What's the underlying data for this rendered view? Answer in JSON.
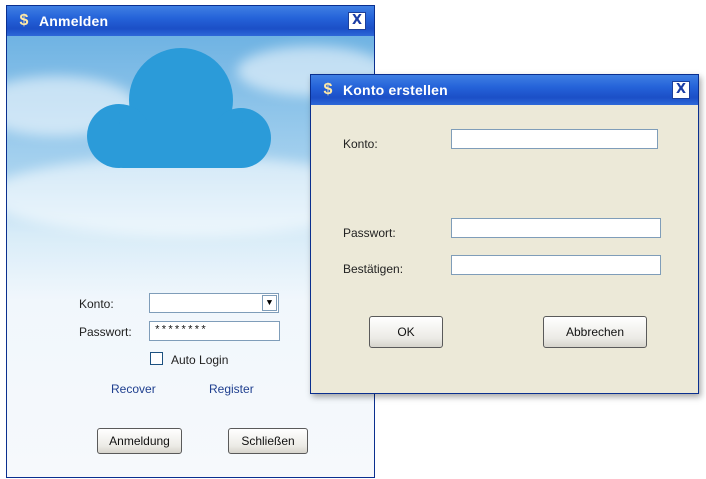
{
  "login_window": {
    "title": "Anmelden",
    "icon": "app-icon",
    "close_label": "X",
    "account_label": "Konto:",
    "account_value": "",
    "password_label": "Passwort:",
    "password_value": "********",
    "auto_login_label": "Auto Login",
    "auto_login_checked": false,
    "recover_link": "Recover",
    "register_link": "Register",
    "login_button": "Anmeldung",
    "close_button": "Schließen"
  },
  "create_window": {
    "title": "Konto erstellen",
    "icon": "app-icon",
    "close_label": "X",
    "account_label": "Konto:",
    "account_value": "",
    "password_label": "Passwort:",
    "password_value": "",
    "confirm_label": "Bestätigen:",
    "confirm_value": "",
    "ok_button": "OK",
    "cancel_button": "Abbrechen"
  },
  "colors": {
    "titlebar": "#2563d9",
    "cloud": "#2b9bd9",
    "dialog_bg": "#ece9d8",
    "link": "#1f3f8f"
  }
}
